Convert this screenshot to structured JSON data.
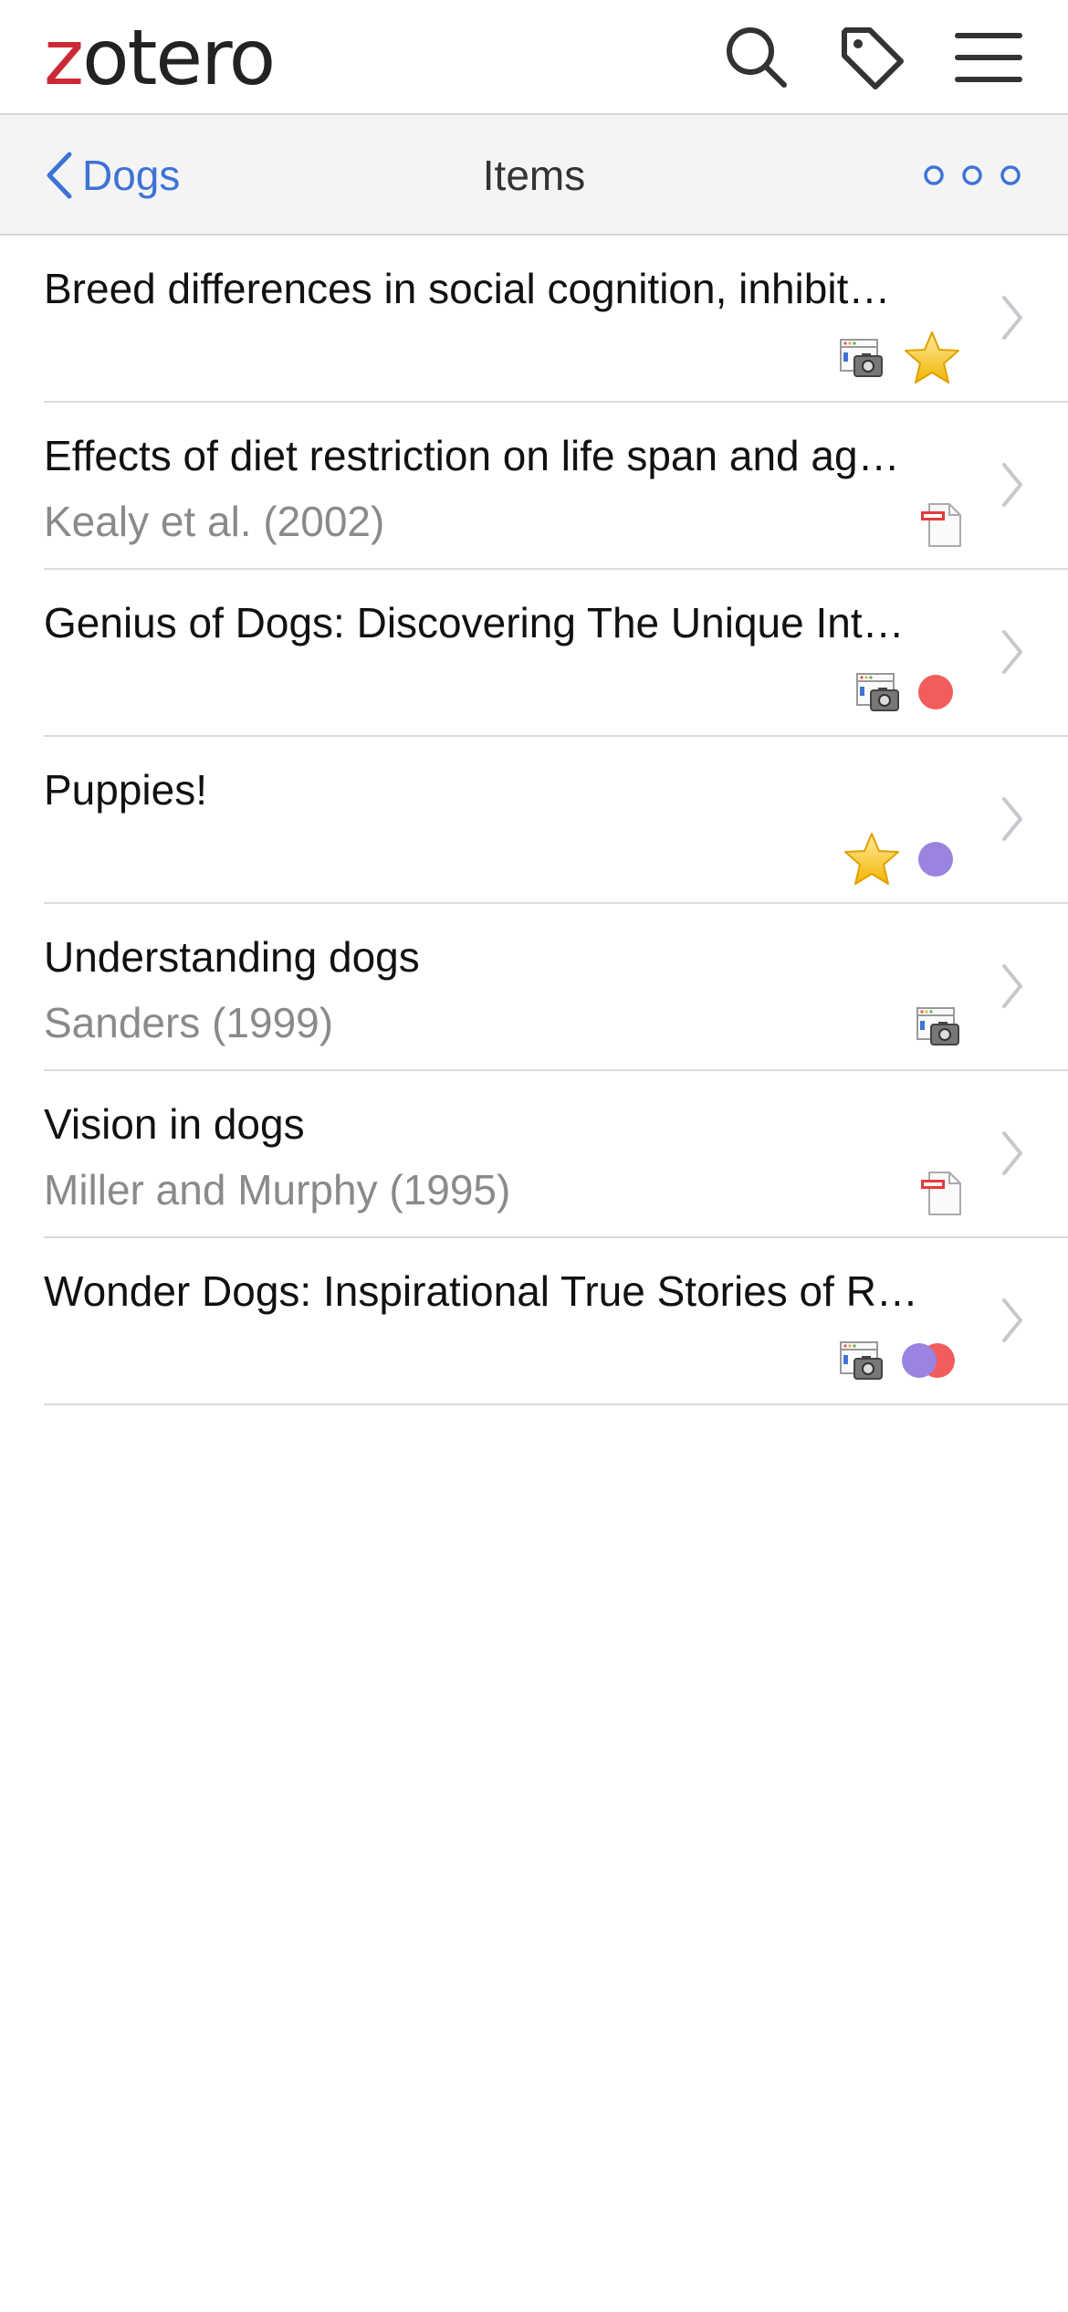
{
  "header": {
    "logo_first_letter": "z",
    "logo_rest": "otero",
    "icons": [
      "search-icon",
      "tag-icon",
      "hamburger-menu-icon"
    ]
  },
  "nav": {
    "back_label": "Dogs",
    "title": "Items",
    "more_icon": "ellipsis-icon"
  },
  "colors": {
    "accent": "#3e73d6",
    "brand_red": "#cc2936",
    "tag_red": "#f25c5c",
    "tag_purple": "#9b84e0",
    "subtitle_gray": "#8a8a8a",
    "separator": "#dcdcdc"
  },
  "items": [
    {
      "title": "Breed differences in social cognition, inhibit…",
      "subtitle": "",
      "attachment": "snapshot-icon",
      "tags": [
        "star-emoji"
      ]
    },
    {
      "title": "Effects of diet restriction on life span and ag…",
      "subtitle": "Kealy et al. (2002)",
      "attachment": "pdf-icon",
      "tags": []
    },
    {
      "title": "Genius of Dogs: Discovering The Unique Int…",
      "subtitle": "",
      "attachment": "snapshot-icon",
      "tags": [
        "red-tag"
      ]
    },
    {
      "title": "Puppies!",
      "subtitle": "",
      "attachment": "",
      "tags": [
        "star-emoji",
        "purple-tag"
      ]
    },
    {
      "title": "Understanding dogs",
      "subtitle": "Sanders (1999)",
      "attachment": "snapshot-icon",
      "tags": []
    },
    {
      "title": "Vision in dogs",
      "subtitle": "Miller and Murphy (1995)",
      "attachment": "pdf-icon",
      "tags": []
    },
    {
      "title": "Wonder Dogs: Inspirational True Stories of R…",
      "subtitle": "",
      "attachment": "snapshot-icon",
      "tags": [
        "purple-tag",
        "red-tag"
      ]
    }
  ]
}
